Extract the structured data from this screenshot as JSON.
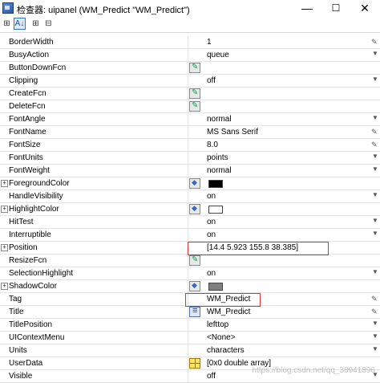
{
  "window": {
    "title": "检查器: uipanel (WM_Predict \"WM_Predict\")",
    "minimize_label": "—",
    "maximize_label": "☐",
    "close_label": "✕"
  },
  "toolbar": {
    "categorized_label": "⊞",
    "sorted_label": "A↓",
    "expand_label": "⊞",
    "collapse_label": "⊟"
  },
  "properties": [
    {
      "name": "BorderWidth",
      "value": "1",
      "icon": "",
      "right": "edit",
      "expand": false
    },
    {
      "name": "BusyAction",
      "value": "queue",
      "icon": "",
      "right": "dropdown",
      "expand": false
    },
    {
      "name": "ButtonDownFcn",
      "value": "",
      "icon": "callback",
      "right": "",
      "expand": false
    },
    {
      "name": "Clipping",
      "value": "off",
      "icon": "",
      "right": "dropdown",
      "expand": false
    },
    {
      "name": "CreateFcn",
      "value": "",
      "icon": "callback",
      "right": "",
      "expand": false
    },
    {
      "name": "DeleteFcn",
      "value": "",
      "icon": "callback",
      "right": "",
      "expand": false
    },
    {
      "name": "FontAngle",
      "value": "normal",
      "icon": "",
      "right": "dropdown",
      "expand": false
    },
    {
      "name": "FontName",
      "value": "MS Sans Serif",
      "icon": "",
      "right": "edit",
      "expand": false
    },
    {
      "name": "FontSize",
      "value": "8.0",
      "icon": "",
      "right": "edit",
      "expand": false
    },
    {
      "name": "FontUnits",
      "value": "points",
      "icon": "",
      "right": "dropdown",
      "expand": false
    },
    {
      "name": "FontWeight",
      "value": "normal",
      "icon": "",
      "right": "dropdown",
      "expand": false
    },
    {
      "name": "ForegroundColor",
      "value": "",
      "icon": "paint",
      "right": "",
      "expand": true,
      "swatch": "#000000"
    },
    {
      "name": "HandleVisibility",
      "value": "on",
      "icon": "",
      "right": "dropdown",
      "expand": false
    },
    {
      "name": "HighlightColor",
      "value": "",
      "icon": "paint",
      "right": "",
      "expand": true,
      "swatch": "#ffffff"
    },
    {
      "name": "HitTest",
      "value": "on",
      "icon": "",
      "right": "dropdown",
      "expand": false
    },
    {
      "name": "Interruptible",
      "value": "on",
      "icon": "",
      "right": "dropdown",
      "expand": false
    },
    {
      "name": "Position",
      "value": "[14.4 5.923 155.8 38.385]",
      "icon": "",
      "right": "",
      "expand": true
    },
    {
      "name": "ResizeFcn",
      "value": "",
      "icon": "callback",
      "right": "",
      "expand": false
    },
    {
      "name": "SelectionHighlight",
      "value": "on",
      "icon": "",
      "right": "dropdown",
      "expand": false
    },
    {
      "name": "ShadowColor",
      "value": "",
      "icon": "paint",
      "right": "",
      "expand": true,
      "swatch": "#808080"
    },
    {
      "name": "Tag",
      "value": "WM_Predict",
      "icon": "",
      "right": "edit",
      "expand": false
    },
    {
      "name": "Title",
      "value": "WM_Predict",
      "icon": "string",
      "right": "edit",
      "expand": false
    },
    {
      "name": "TitlePosition",
      "value": "lefttop",
      "icon": "",
      "right": "dropdown",
      "expand": false
    },
    {
      "name": "UIContextMenu",
      "value": "<None>",
      "icon": "",
      "right": "dropdown",
      "expand": false
    },
    {
      "name": "Units",
      "value": "characters",
      "icon": "",
      "right": "dropdown",
      "expand": false
    },
    {
      "name": "UserData",
      "value": "[0x0  double array]",
      "icon": "array",
      "right": "",
      "expand": false
    },
    {
      "name": "Visible",
      "value": "off",
      "icon": "",
      "right": "dropdown",
      "expand": false
    }
  ],
  "watermark": "https://blog.csdn.net/qq_38941896",
  "colors": {
    "highlight_box": "#e03030",
    "selection": "#2c78c8"
  }
}
